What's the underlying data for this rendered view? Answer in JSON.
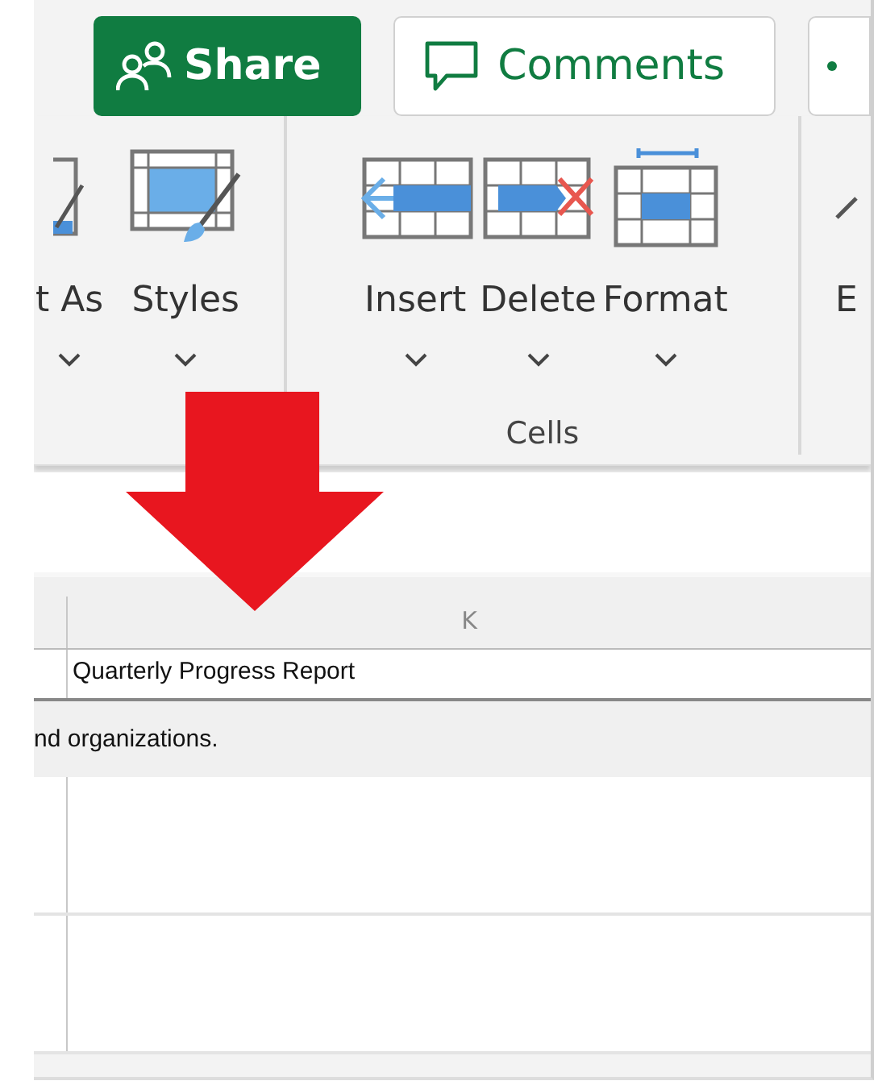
{
  "top_buttons": [
    {
      "kind": "share",
      "label": "Share"
    },
    {
      "kind": "comments",
      "label": "Comments"
    },
    {
      "kind": "more"
    }
  ],
  "ribbon": {
    "groups": [
      {
        "items": [
          {
            "kind": "format_as_table",
            "label": "t As"
          },
          {
            "kind": "cell_styles",
            "label": "Styles"
          }
        ]
      },
      {
        "label": "Cells",
        "items": [
          {
            "kind": "insert",
            "label": "Insert"
          },
          {
            "kind": "delete",
            "label": "Delete"
          },
          {
            "kind": "format",
            "label": "Format"
          }
        ]
      },
      {
        "items": [
          {
            "kind": "editing",
            "label": "E"
          }
        ]
      }
    ]
  },
  "sheet": {
    "column_header": "K",
    "rows": [
      {
        "text": "Quarterly Progress Report",
        "kind": "title"
      },
      {
        "text": "nd organizations.",
        "kind": "band"
      },
      {
        "kind": "empty"
      },
      {
        "kind": "empty"
      }
    ]
  },
  "annotation": {
    "kind": "down_arrow"
  }
}
